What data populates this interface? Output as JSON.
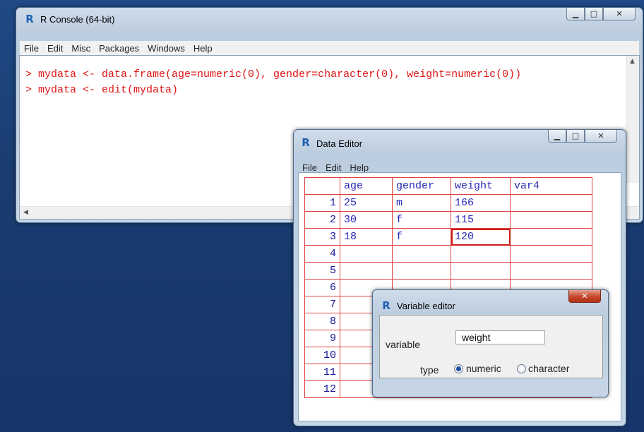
{
  "console": {
    "title": "R Console (64-bit)",
    "menu": [
      "File",
      "Edit",
      "Misc",
      "Packages",
      "Windows",
      "Help"
    ],
    "lines": [
      "> mydata <- data.frame(age=numeric(0), gender=character(0), weight=numeric(0))",
      "> mydata <- edit(mydata)"
    ]
  },
  "data_editor": {
    "title": "Data Editor",
    "menu": [
      "File",
      "Edit",
      "Help"
    ],
    "columns": [
      "age",
      "gender",
      "weight",
      "var4"
    ],
    "rows": [
      {
        "num": "1",
        "cells": [
          "25",
          "m",
          "166",
          ""
        ]
      },
      {
        "num": "2",
        "cells": [
          "30",
          "f",
          "115",
          ""
        ]
      },
      {
        "num": "3",
        "cells": [
          "18",
          "f",
          "120",
          ""
        ]
      },
      {
        "num": "4",
        "cells": [
          "",
          "",
          "",
          ""
        ]
      },
      {
        "num": "5",
        "cells": [
          "",
          "",
          "",
          ""
        ]
      },
      {
        "num": "6",
        "cells": [
          "",
          "",
          "",
          ""
        ]
      },
      {
        "num": "7",
        "cells": [
          "",
          "",
          "",
          ""
        ]
      },
      {
        "num": "8",
        "cells": [
          "",
          "",
          "",
          ""
        ]
      },
      {
        "num": "9",
        "cells": [
          "",
          "",
          "",
          ""
        ]
      },
      {
        "num": "10",
        "cells": [
          "",
          "",
          "",
          ""
        ]
      },
      {
        "num": "11",
        "cells": [
          "",
          "",
          "",
          ""
        ]
      },
      {
        "num": "12",
        "cells": [
          "",
          "",
          "",
          ""
        ]
      }
    ],
    "selected_cell": {
      "row": "3",
      "column": "weight"
    }
  },
  "variable_editor": {
    "title": "Variable editor",
    "variable_label": "variable",
    "variable_value": "weight",
    "type_label": "type",
    "type_options": [
      "numeric",
      "character"
    ],
    "type_selected": "numeric"
  },
  "icons": {
    "app_icon": "r-logo-icon",
    "minimize": "minimize-icon",
    "maximize": "maximize-icon",
    "close": "close-icon"
  },
  "colors": {
    "console_text": "#e01515",
    "grid_lines": "#e04242",
    "cell_text": "#2a2ab8",
    "desktop": "#19396b"
  }
}
